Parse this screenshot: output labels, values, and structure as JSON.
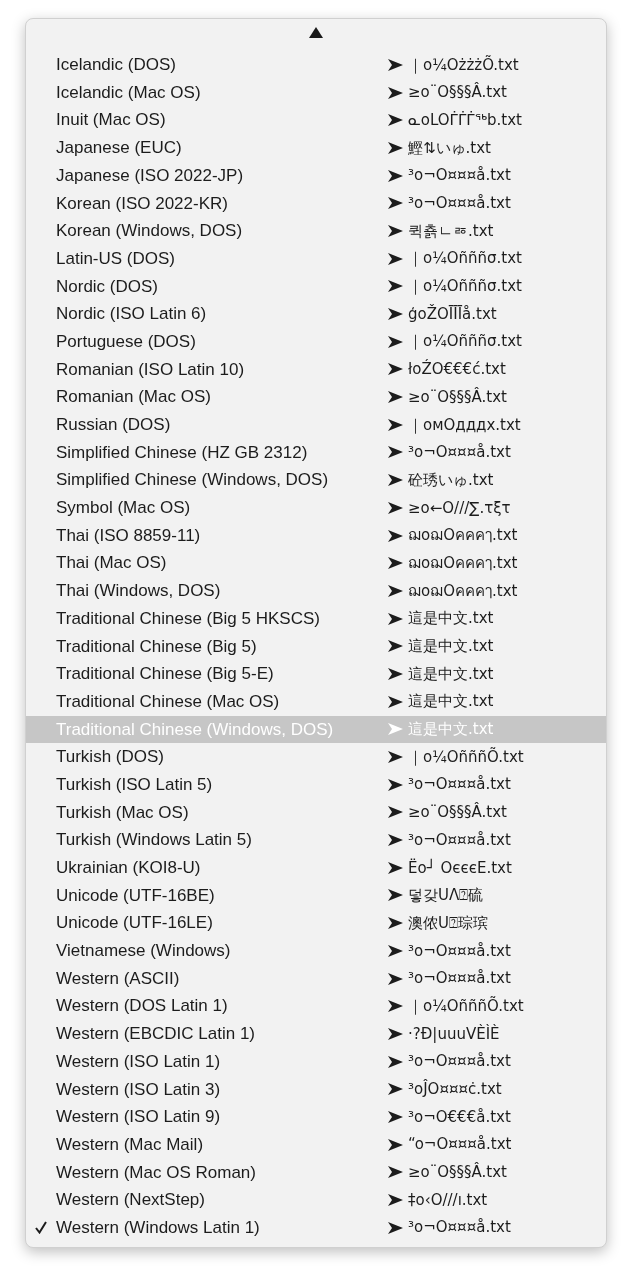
{
  "menu": {
    "items": [
      {
        "label": "Icelandic (DOS)",
        "sample": "｜o¼OżżżÕ.txt",
        "selected": false,
        "checked": false
      },
      {
        "label": "Icelandic (Mac OS)",
        "sample": "≥o¨O§§§Â.txt",
        "selected": false,
        "checked": false
      },
      {
        "label": "Inuit (Mac OS)",
        "sample": "ᓇoLOᒦᒦᒦᖅb.txt",
        "selected": false,
        "checked": false
      },
      {
        "label": "Japanese (EUC)",
        "sample": "鰹⇅いゅ.txt",
        "selected": false,
        "checked": false
      },
      {
        "label": "Japanese (ISO 2022-JP)",
        "sample": "³o¬O¤¤¤å.txt",
        "selected": false,
        "checked": false
      },
      {
        "label": "Korean (ISO 2022-KR)",
        "sample": "³o¬O¤¤¤å.txt",
        "selected": false,
        "checked": false
      },
      {
        "label": "Korean (Windows, DOS)",
        "sample": "퀵춁ㄴㅭ.txt",
        "selected": false,
        "checked": false
      },
      {
        "label": "Latin-US (DOS)",
        "sample": "｜o¼Oñññσ.txt",
        "selected": false,
        "checked": false
      },
      {
        "label": "Nordic (DOS)",
        "sample": "｜o¼Oñññσ.txt",
        "selected": false,
        "checked": false
      },
      {
        "label": "Nordic (ISO Latin 6)",
        "sample": "ģoŽOĪĪĪå.txt",
        "selected": false,
        "checked": false
      },
      {
        "label": "Portuguese (DOS)",
        "sample": "｜o¼Oñññσ.txt",
        "selected": false,
        "checked": false
      },
      {
        "label": "Romanian (ISO Latin 10)",
        "sample": "łoŹO€€€ć.txt",
        "selected": false,
        "checked": false
      },
      {
        "label": "Romanian (Mac OS)",
        "sample": "≥o¨O§§§Â.txt",
        "selected": false,
        "checked": false
      },
      {
        "label": "Russian (DOS)",
        "sample": "｜омОдддх.txt",
        "selected": false,
        "checked": false
      },
      {
        "label": "Simplified Chinese (HZ GB 2312)",
        "sample": "³o¬O¤¤¤å.txt",
        "selected": false,
        "checked": false
      },
      {
        "label": "Simplified Chinese (Windows, DOS)",
        "sample": "砼琇いゅ.txt",
        "selected": false,
        "checked": false
      },
      {
        "label": "Symbol (Mac OS)",
        "sample": "≥o←O///∑.τξτ",
        "selected": false,
        "checked": false
      },
      {
        "label": "Thai (ISO 8859-11)",
        "sample": "ฌoฌOคคคๅ.txt",
        "selected": false,
        "checked": false
      },
      {
        "label": "Thai (Mac OS)",
        "sample": "ฌoฌOคคคๅ.txt",
        "selected": false,
        "checked": false
      },
      {
        "label": "Thai (Windows, DOS)",
        "sample": "ฌoฌOคคคๅ.txt",
        "selected": false,
        "checked": false
      },
      {
        "label": "Traditional Chinese (Big 5 HKSCS)",
        "sample": "這是中文.txt",
        "selected": false,
        "checked": false
      },
      {
        "label": "Traditional Chinese (Big 5)",
        "sample": "這是中文.txt",
        "selected": false,
        "checked": false
      },
      {
        "label": "Traditional Chinese (Big 5-E)",
        "sample": "這是中文.txt",
        "selected": false,
        "checked": false
      },
      {
        "label": "Traditional Chinese (Mac OS)",
        "sample": "這是中文.txt",
        "selected": false,
        "checked": false
      },
      {
        "label": "Traditional Chinese (Windows, DOS)",
        "sample": "這是中文.txt",
        "selected": true,
        "checked": false
      },
      {
        "label": "Turkish (DOS)",
        "sample": "｜o¼OñññÕ.txt",
        "selected": false,
        "checked": false
      },
      {
        "label": "Turkish (ISO Latin 5)",
        "sample": "³o¬O¤¤¤å.txt",
        "selected": false,
        "checked": false
      },
      {
        "label": "Turkish (Mac OS)",
        "sample": "≥o¨O§§§Â.txt",
        "selected": false,
        "checked": false
      },
      {
        "label": "Turkish (Windows Latin 5)",
        "sample": "³o¬O¤¤¤å.txt",
        "selected": false,
        "checked": false
      },
      {
        "label": "Ukrainian (KOI8-U)",
        "sample": "Ëo┘ OєєєE.txt",
        "selected": false,
        "checked": false
      },
      {
        "label": "Unicode (UTF-16BE)",
        "sample": "덯갖UΛ⍰硫",
        "selected": false,
        "checked": false
      },
      {
        "label": "Unicode (UTF-16LE)",
        "sample": "澳侬U⍰琮瑸",
        "selected": false,
        "checked": false
      },
      {
        "label": "Vietnamese (Windows)",
        "sample": "³o¬O¤¤¤å.txt",
        "selected": false,
        "checked": false
      },
      {
        "label": "Western (ASCII)",
        "sample": "³o¬O¤¤¤å.txt",
        "selected": false,
        "checked": false
      },
      {
        "label": "Western (DOS Latin 1)",
        "sample": "｜o¼OñññÕ.txt",
        "selected": false,
        "checked": false
      },
      {
        "label": "Western (EBCDIC Latin 1)",
        "sample": "·?Ð|uuuVÈÌÈ",
        "selected": false,
        "checked": false
      },
      {
        "label": "Western (ISO Latin 1)",
        "sample": "³o¬O¤¤¤å.txt",
        "selected": false,
        "checked": false
      },
      {
        "label": "Western (ISO Latin 3)",
        "sample": "³oĴO¤¤¤ċ.txt",
        "selected": false,
        "checked": false
      },
      {
        "label": "Western (ISO Latin 9)",
        "sample": "³o¬O€€€å.txt",
        "selected": false,
        "checked": false
      },
      {
        "label": "Western (Mac Mail)",
        "sample": "“o¬O¤¤¤å.txt",
        "selected": false,
        "checked": false
      },
      {
        "label": "Western (Mac OS Roman)",
        "sample": "≥o¨O§§§Â.txt",
        "selected": false,
        "checked": false
      },
      {
        "label": "Western (NextStep)",
        "sample": "‡o‹O///ı.txt",
        "selected": false,
        "checked": false
      },
      {
        "label": "Western (Windows Latin 1)",
        "sample": "³o¬O¤¤¤å.txt",
        "selected": false,
        "checked": true
      }
    ]
  }
}
